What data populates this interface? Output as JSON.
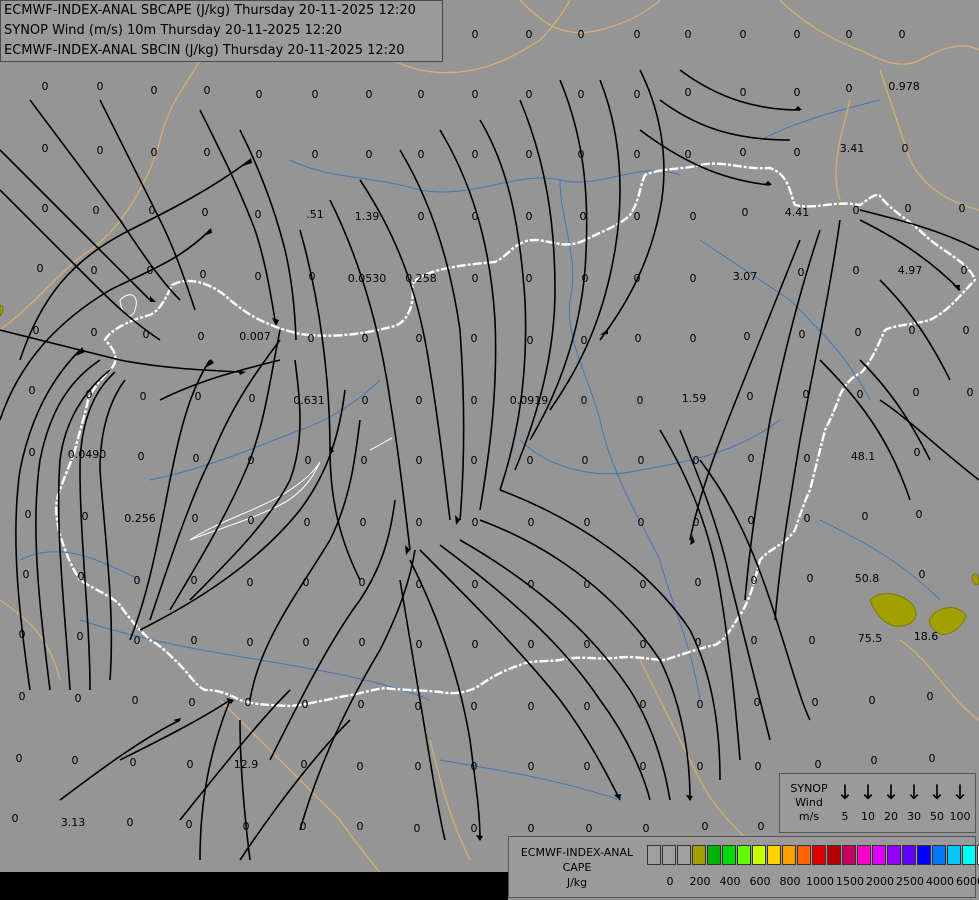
{
  "title_lines": [
    "ECMWF-INDEX-ANAL SBCAPE (J/kg) Thursday 20-11-2025 12:20",
    "SYNOP Wind (m/s) 10m Thursday 20-11-2025 12:20",
    "ECMWF-INDEX-ANAL SBCIN (J/kg) Thursday 20-11-2025 12:20"
  ],
  "wind_legend": {
    "title": [
      "SYNOP",
      "Wind",
      "m/s"
    ],
    "arrow_glyph": "↓",
    "speeds": [
      "5",
      "10",
      "20",
      "30",
      "50",
      "100"
    ]
  },
  "cape_legend": {
    "title": [
      "ECMWF-INDEX-ANAL",
      "CAPE",
      "J/kg"
    ],
    "colors": [
      "#a0a0a0",
      "#a0a0a0",
      "#a0a0a0",
      "#a0a000",
      "#00b400",
      "#00dc00",
      "#64ff00",
      "#c8ff00",
      "#ffd200",
      "#ffa000",
      "#ff6400",
      "#dc0000",
      "#b40000",
      "#c80064",
      "#ff00c8",
      "#dc00ff",
      "#9600ff",
      "#6400ff",
      "#0000ff",
      "#0078ff",
      "#00c8ff",
      "#00ffff",
      "#ffffff"
    ],
    "labels": [
      "0",
      "200",
      "400",
      "600",
      "800",
      "1000",
      "1500",
      "2000",
      "2500",
      "4000",
      "6000"
    ]
  },
  "map_values": [
    [
      "0",
      45,
      38
    ],
    [
      "0",
      100,
      38
    ],
    [
      "0",
      154,
      38
    ],
    [
      "0",
      207,
      38
    ],
    [
      "0",
      259,
      38
    ],
    [
      "0",
      315,
      38
    ],
    [
      "0",
      369,
      38
    ],
    [
      "0",
      421,
      38
    ],
    [
      "0",
      475,
      38
    ],
    [
      "0",
      529,
      38
    ],
    [
      "0",
      581,
      38
    ],
    [
      "0",
      637,
      38
    ],
    [
      "0",
      688,
      38
    ],
    [
      "0",
      743,
      38
    ],
    [
      "0",
      797,
      38
    ],
    [
      "0",
      849,
      38
    ],
    [
      "0",
      902,
      38
    ],
    [
      "0",
      45,
      90
    ],
    [
      "0",
      100,
      90
    ],
    [
      "0",
      154,
      94
    ],
    [
      "0",
      207,
      94
    ],
    [
      "0",
      259,
      98
    ],
    [
      "0",
      315,
      98
    ],
    [
      "0",
      369,
      98
    ],
    [
      "0",
      421,
      98
    ],
    [
      "0",
      475,
      98
    ],
    [
      "0",
      529,
      98
    ],
    [
      "0",
      581,
      98
    ],
    [
      "0",
      637,
      98
    ],
    [
      "0",
      688,
      96
    ],
    [
      "0",
      743,
      96
    ],
    [
      "0",
      797,
      96
    ],
    [
      "0",
      849,
      92
    ],
    [
      "0.978",
      904,
      90
    ],
    [
      "0",
      45,
      152
    ],
    [
      "0",
      100,
      154
    ],
    [
      "0",
      154,
      156
    ],
    [
      "0",
      207,
      156
    ],
    [
      "0",
      259,
      158
    ],
    [
      "0",
      315,
      158
    ],
    [
      "0",
      369,
      158
    ],
    [
      "0",
      421,
      158
    ],
    [
      "0",
      475,
      158
    ],
    [
      "0",
      529,
      158
    ],
    [
      "0",
      581,
      158
    ],
    [
      "0",
      637,
      158
    ],
    [
      "0",
      688,
      158
    ],
    [
      "0",
      743,
      156
    ],
    [
      "0",
      797,
      156
    ],
    [
      "3.41",
      852,
      152
    ],
    [
      "0",
      905,
      152
    ],
    [
      "0",
      45,
      212
    ],
    [
      "0",
      96,
      214
    ],
    [
      "0",
      152,
      214
    ],
    [
      "0",
      205,
      216
    ],
    [
      "0",
      258,
      218
    ],
    [
      ".51",
      315,
      218
    ],
    [
      "1.39",
      367,
      220
    ],
    [
      "0",
      421,
      220
    ],
    [
      "0",
      475,
      220
    ],
    [
      "0",
      529,
      220
    ],
    [
      "0",
      583,
      220
    ],
    [
      "0",
      637,
      220
    ],
    [
      "0",
      693,
      220
    ],
    [
      "0",
      745,
      216
    ],
    [
      "4.41",
      797,
      216
    ],
    [
      "0",
      856,
      214
    ],
    [
      "0",
      908,
      212
    ],
    [
      "0",
      962,
      212
    ],
    [
      "0",
      40,
      272
    ],
    [
      "0",
      94,
      274
    ],
    [
      "0",
      150,
      274
    ],
    [
      "0",
      203,
      278
    ],
    [
      "0",
      258,
      280
    ],
    [
      "0",
      312,
      280
    ],
    [
      "0.0530",
      367,
      282
    ],
    [
      "0.258",
      421,
      282
    ],
    [
      "0",
      475,
      282
    ],
    [
      "0",
      529,
      282
    ],
    [
      "0",
      585,
      282
    ],
    [
      "0",
      637,
      282
    ],
    [
      "0",
      693,
      282
    ],
    [
      "3.07",
      745,
      280
    ],
    [
      "0",
      801,
      276
    ],
    [
      "0",
      856,
      274
    ],
    [
      "4.97",
      910,
      274
    ],
    [
      "0",
      964,
      274
    ],
    [
      "0",
      36,
      334
    ],
    [
      "0",
      94,
      336
    ],
    [
      "0",
      146,
      338
    ],
    [
      "0",
      201,
      340
    ],
    [
      "0.007",
      255,
      340
    ],
    [
      "0",
      311,
      342
    ],
    [
      "0",
      365,
      342
    ],
    [
      "0",
      419,
      342
    ],
    [
      "0",
      474,
      342
    ],
    [
      "0",
      530,
      344
    ],
    [
      "0",
      584,
      344
    ],
    [
      "0",
      638,
      342
    ],
    [
      "0",
      693,
      342
    ],
    [
      "0",
      747,
      340
    ],
    [
      "0",
      802,
      338
    ],
    [
      "0",
      858,
      336
    ],
    [
      "0",
      912,
      334
    ],
    [
      "0",
      966,
      334
    ],
    [
      "0",
      32,
      394
    ],
    [
      "0",
      89,
      398
    ],
    [
      "0",
      143,
      400
    ],
    [
      "0",
      198,
      400
    ],
    [
      "0",
      252,
      402
    ],
    [
      "0.631",
      309,
      404
    ],
    [
      "0",
      365,
      404
    ],
    [
      "0",
      419,
      404
    ],
    [
      "0",
      474,
      404
    ],
    [
      "0.0919",
      529,
      404
    ],
    [
      "0",
      584,
      404
    ],
    [
      "0",
      640,
      404
    ],
    [
      "1.59",
      694,
      402
    ],
    [
      "0",
      750,
      400
    ],
    [
      "0",
      806,
      398
    ],
    [
      "0",
      860,
      398
    ],
    [
      "0",
      916,
      396
    ],
    [
      "0",
      970,
      396
    ],
    [
      "0",
      32,
      456
    ],
    [
      "0.0490",
      87,
      458
    ],
    [
      "0",
      141,
      460
    ],
    [
      "0",
      196,
      462
    ],
    [
      "0",
      251,
      464
    ],
    [
      "0",
      308,
      464
    ],
    [
      "0",
      364,
      464
    ],
    [
      "0",
      419,
      464
    ],
    [
      "0",
      474,
      464
    ],
    [
      "0",
      530,
      464
    ],
    [
      "0",
      585,
      464
    ],
    [
      "0",
      641,
      464
    ],
    [
      "0",
      696,
      464
    ],
    [
      "0",
      751,
      462
    ],
    [
      "0",
      807,
      462
    ],
    [
      "48.1",
      863,
      460
    ],
    [
      "0",
      917,
      456
    ],
    [
      "0",
      28,
      518
    ],
    [
      "0",
      85,
      520
    ],
    [
      "0.256",
      140,
      522
    ],
    [
      "0",
      195,
      522
    ],
    [
      "0",
      251,
      524
    ],
    [
      "0",
      307,
      526
    ],
    [
      "0",
      363,
      526
    ],
    [
      "0",
      419,
      526
    ],
    [
      "0",
      475,
      526
    ],
    [
      "0",
      531,
      526
    ],
    [
      "0",
      587,
      526
    ],
    [
      "0",
      641,
      526
    ],
    [
      "0",
      696,
      526
    ],
    [
      "0",
      751,
      524
    ],
    [
      "0",
      807,
      522
    ],
    [
      "0",
      865,
      520
    ],
    [
      "0",
      919,
      518
    ],
    [
      "0",
      26,
      578
    ],
    [
      "0",
      81,
      580
    ],
    [
      "0",
      137,
      584
    ],
    [
      "0",
      194,
      584
    ],
    [
      "0",
      250,
      586
    ],
    [
      "0",
      306,
      586
    ],
    [
      "0",
      362,
      586
    ],
    [
      "0",
      419,
      588
    ],
    [
      "0",
      475,
      588
    ],
    [
      "0",
      531,
      588
    ],
    [
      "0",
      587,
      588
    ],
    [
      "0",
      643,
      588
    ],
    [
      "0",
      698,
      586
    ],
    [
      "0",
      754,
      584
    ],
    [
      "0",
      810,
      582
    ],
    [
      "50.8",
      867,
      582
    ],
    [
      "0",
      922,
      578
    ],
    [
      "0",
      22,
      638
    ],
    [
      "0",
      80,
      640
    ],
    [
      "0",
      137,
      644
    ],
    [
      "0",
      194,
      644
    ],
    [
      "0",
      250,
      646
    ],
    [
      "0",
      306,
      646
    ],
    [
      "0",
      362,
      646
    ],
    [
      "0",
      419,
      648
    ],
    [
      "0",
      475,
      648
    ],
    [
      "0",
      531,
      648
    ],
    [
      "0",
      587,
      648
    ],
    [
      "0",
      643,
      648
    ],
    [
      "0",
      698,
      646
    ],
    [
      "0",
      754,
      644
    ],
    [
      "0",
      812,
      644
    ],
    [
      "75.5",
      870,
      642
    ],
    [
      "18.6",
      926,
      640
    ],
    [
      "0",
      22,
      700
    ],
    [
      "0",
      78,
      702
    ],
    [
      "0",
      135,
      704
    ],
    [
      "0",
      192,
      706
    ],
    [
      "0",
      248,
      706
    ],
    [
      "0",
      305,
      708
    ],
    [
      "0",
      361,
      708
    ],
    [
      "0",
      418,
      710
    ],
    [
      "0",
      474,
      710
    ],
    [
      "0",
      531,
      710
    ],
    [
      "0",
      587,
      710
    ],
    [
      "0",
      643,
      708
    ],
    [
      "0",
      700,
      708
    ],
    [
      "0",
      757,
      706
    ],
    [
      "0",
      815,
      706
    ],
    [
      "0",
      872,
      704
    ],
    [
      "0",
      930,
      700
    ],
    [
      "0",
      19,
      762
    ],
    [
      "0",
      75,
      764
    ],
    [
      "0",
      133,
      766
    ],
    [
      "0",
      190,
      768
    ],
    [
      "12.9",
      246,
      768
    ],
    [
      "0",
      304,
      768
    ],
    [
      "0",
      360,
      770
    ],
    [
      "0",
      418,
      770
    ],
    [
      "0",
      474,
      770
    ],
    [
      "0",
      531,
      770
    ],
    [
      "0",
      587,
      770
    ],
    [
      "0",
      643,
      770
    ],
    [
      "0",
      700,
      770
    ],
    [
      "0",
      758,
      770
    ],
    [
      "0",
      818,
      768
    ],
    [
      "0",
      874,
      764
    ],
    [
      "0",
      932,
      762
    ],
    [
      "0",
      15,
      822
    ],
    [
      "3.13",
      73,
      826
    ],
    [
      "0",
      130,
      826
    ],
    [
      "0",
      189,
      828
    ],
    [
      "0",
      246,
      830
    ],
    [
      "0",
      303,
      830
    ],
    [
      "0",
      360,
      830
    ],
    [
      "0",
      417,
      832
    ],
    [
      "0",
      474,
      832
    ],
    [
      "0",
      531,
      832
    ],
    [
      "0",
      589,
      832
    ],
    [
      "0",
      646,
      832
    ],
    [
      "0",
      705,
      830
    ],
    [
      "0",
      761,
      830
    ],
    [
      "0",
      819,
      826
    ],
    [
      "0",
      876,
      826
    ],
    [
      "0",
      933,
      824
    ]
  ]
}
